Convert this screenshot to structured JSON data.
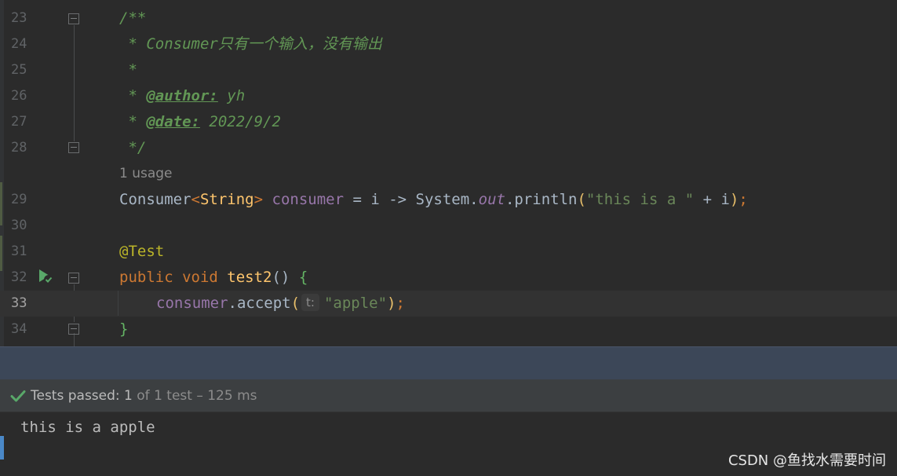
{
  "editor": {
    "lines": [
      {
        "num": "23"
      },
      {
        "num": "24",
        "doc_prefix": " * ",
        "doc_text": "Consumer只有一个输入，没有输出"
      },
      {
        "num": "25",
        "doc_text": " *"
      },
      {
        "num": "26",
        "doc_prefix": " * ",
        "tag": "@author:",
        "doc_text": " yh"
      },
      {
        "num": "27",
        "doc_prefix": " * ",
        "tag": "@date:",
        "doc_text": " 2022/9/2"
      },
      {
        "num": "28",
        "doc_text": " */"
      },
      {
        "num": "29"
      },
      {
        "num": "30"
      },
      {
        "num": "31"
      },
      {
        "num": "32"
      },
      {
        "num": "33"
      },
      {
        "num": "34"
      }
    ],
    "line23_text": "/**",
    "usage_hint": "1 usage",
    "line29": {
      "type": "Consumer",
      "lt": "<",
      "generic": "String",
      "gt": ">",
      "var": "consumer",
      "op": " = i -> System.",
      "field": "out",
      "call": ".println",
      "open": "(",
      "str": "\"this is a \"",
      "rest": " + i",
      "close": ")",
      "semi": ";"
    },
    "line31": "@Test",
    "line32": {
      "kw": "public void ",
      "method": "test2",
      "parens": "()",
      "brace": "{"
    },
    "line33": {
      "var": "consumer",
      "call": ".accept",
      "open": "(",
      "hint": "t:",
      "str": "\"apple\"",
      "close": ")",
      "semi": ";"
    },
    "line34": "}"
  },
  "run_panel": {
    "status_prefix": "Tests passed: ",
    "status_count": "1",
    "status_detail": " of 1 test – 125 ms",
    "check_icon": "check-icon",
    "console_output": "this is a apple"
  },
  "watermark": "CSDN @鱼找水需要时间",
  "colors": {
    "background": "#2b2b2b",
    "doc_comment": "#629755",
    "keyword": "#cc7832",
    "string": "#6a8759",
    "method": "#ffc66d",
    "field": "#9876aa",
    "annotation": "#bbb529",
    "success": "#59a869"
  }
}
